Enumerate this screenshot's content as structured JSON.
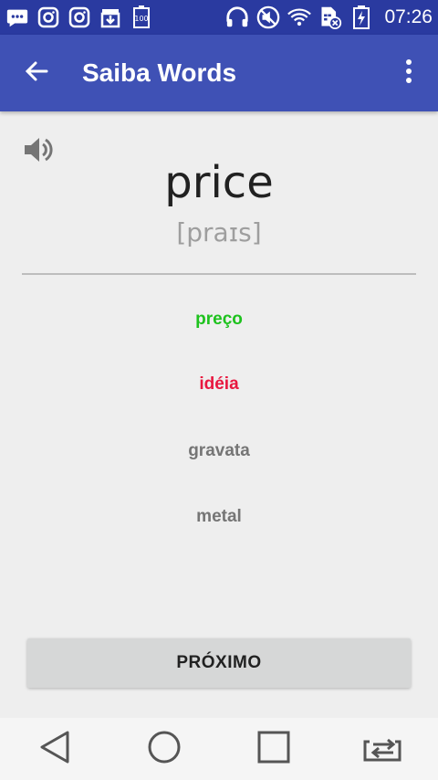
{
  "status_bar": {
    "time": "07:26",
    "icons": [
      "chat-icon",
      "instagram-icon",
      "instagram-icon",
      "download-box-icon",
      "battery-saver-100-icon",
      "headphones-icon",
      "mute-icon",
      "wifi-icon",
      "sim-error-icon",
      "battery-charging-icon"
    ]
  },
  "app_bar": {
    "title": "Saiba Words",
    "back_icon": "arrow-left-icon",
    "menu_icon": "more-vert-icon"
  },
  "card": {
    "speaker_icon": "volume-icon",
    "word": "price",
    "phonetic": "[praɪs]"
  },
  "options": [
    {
      "label": "preço",
      "state": "correct",
      "color": "#1ec21e"
    },
    {
      "label": "idéia",
      "state": "wrong",
      "color": "#e8173f"
    },
    {
      "label": "gravata",
      "state": "neutral",
      "color": "#757575"
    },
    {
      "label": "metal",
      "state": "neutral",
      "color": "#757575"
    }
  ],
  "next_button": {
    "label": "PRÓXIMO"
  },
  "nav_bar": {
    "icons": [
      "back-triangle-icon",
      "home-circle-icon",
      "recents-square-icon",
      "switch-app-icon"
    ]
  },
  "colors": {
    "status_bar": "#2a3aa0",
    "app_bar": "#3f51b5",
    "background": "#eeeeee"
  }
}
